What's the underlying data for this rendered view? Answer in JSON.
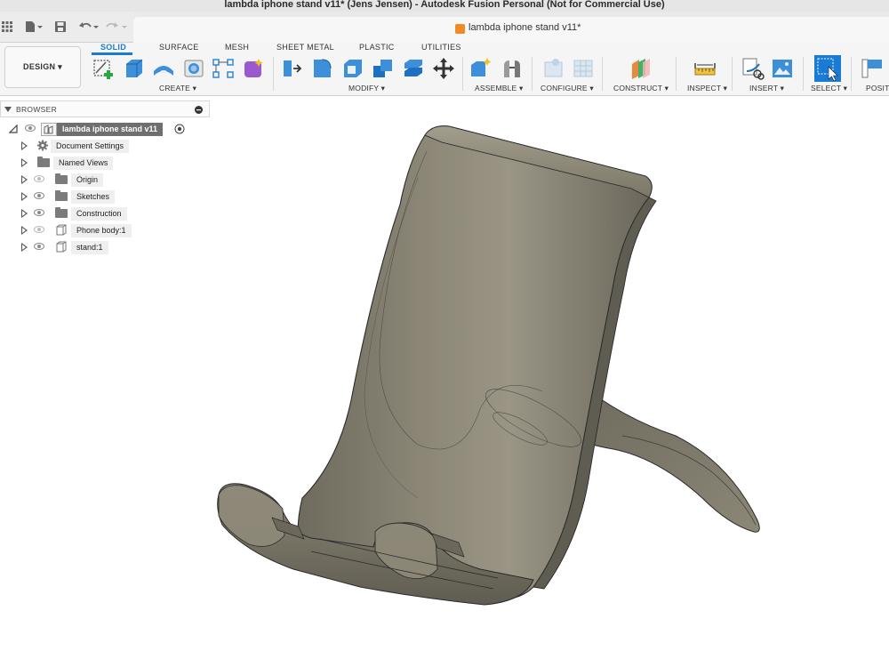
{
  "window": {
    "title": "lambda iphone stand v11* (Jens Jensen) - Autodesk Fusion Personal (Not for Commercial Use)"
  },
  "document_tab": {
    "label": "lambda iphone stand v11*",
    "icon": "fusion-cube-icon",
    "icon_color": "#f08a22"
  },
  "quick_access": [
    "grid-icon",
    "file-icon",
    "save-icon",
    "undo-icon",
    "redo-icon"
  ],
  "workspace": {
    "label": "DESIGN ▾"
  },
  "ribbon": {
    "tabs": [
      "SOLID",
      "SURFACE",
      "MESH",
      "SHEET METAL",
      "PLASTIC",
      "UTILITIES"
    ],
    "active_tab": "SOLID",
    "accent_color": "#1a7bd4",
    "groups": {
      "create": "CREATE ▾",
      "modify": "MODIFY ▾",
      "assemble": "ASSEMBLE ▾",
      "configure": "CONFIGURE ▾",
      "construct": "CONSTRUCT ▾",
      "inspect": "INSPECT ▾",
      "insert": "INSERT ▾",
      "select": "SELECT ▾",
      "position": "POSITI"
    }
  },
  "browser": {
    "header": "BROWSER",
    "root": "lambda iphone stand v11",
    "items": [
      {
        "label": "Document Settings",
        "icon": "gear-icon",
        "visible": null
      },
      {
        "label": "Named Views",
        "icon": "folder-icon",
        "visible": null
      },
      {
        "label": "Origin",
        "icon": "folder-icon",
        "visible": false
      },
      {
        "label": "Sketches",
        "icon": "folder-icon",
        "visible": true
      },
      {
        "label": "Construction",
        "icon": "folder-icon",
        "visible": true
      },
      {
        "label": "Phone body:1",
        "icon": "body-icon",
        "visible": false
      },
      {
        "label": "stand:1",
        "icon": "body-icon",
        "visible": true
      }
    ]
  },
  "viewport": {
    "model": "phone stand body",
    "model_color": "#7d7868"
  }
}
